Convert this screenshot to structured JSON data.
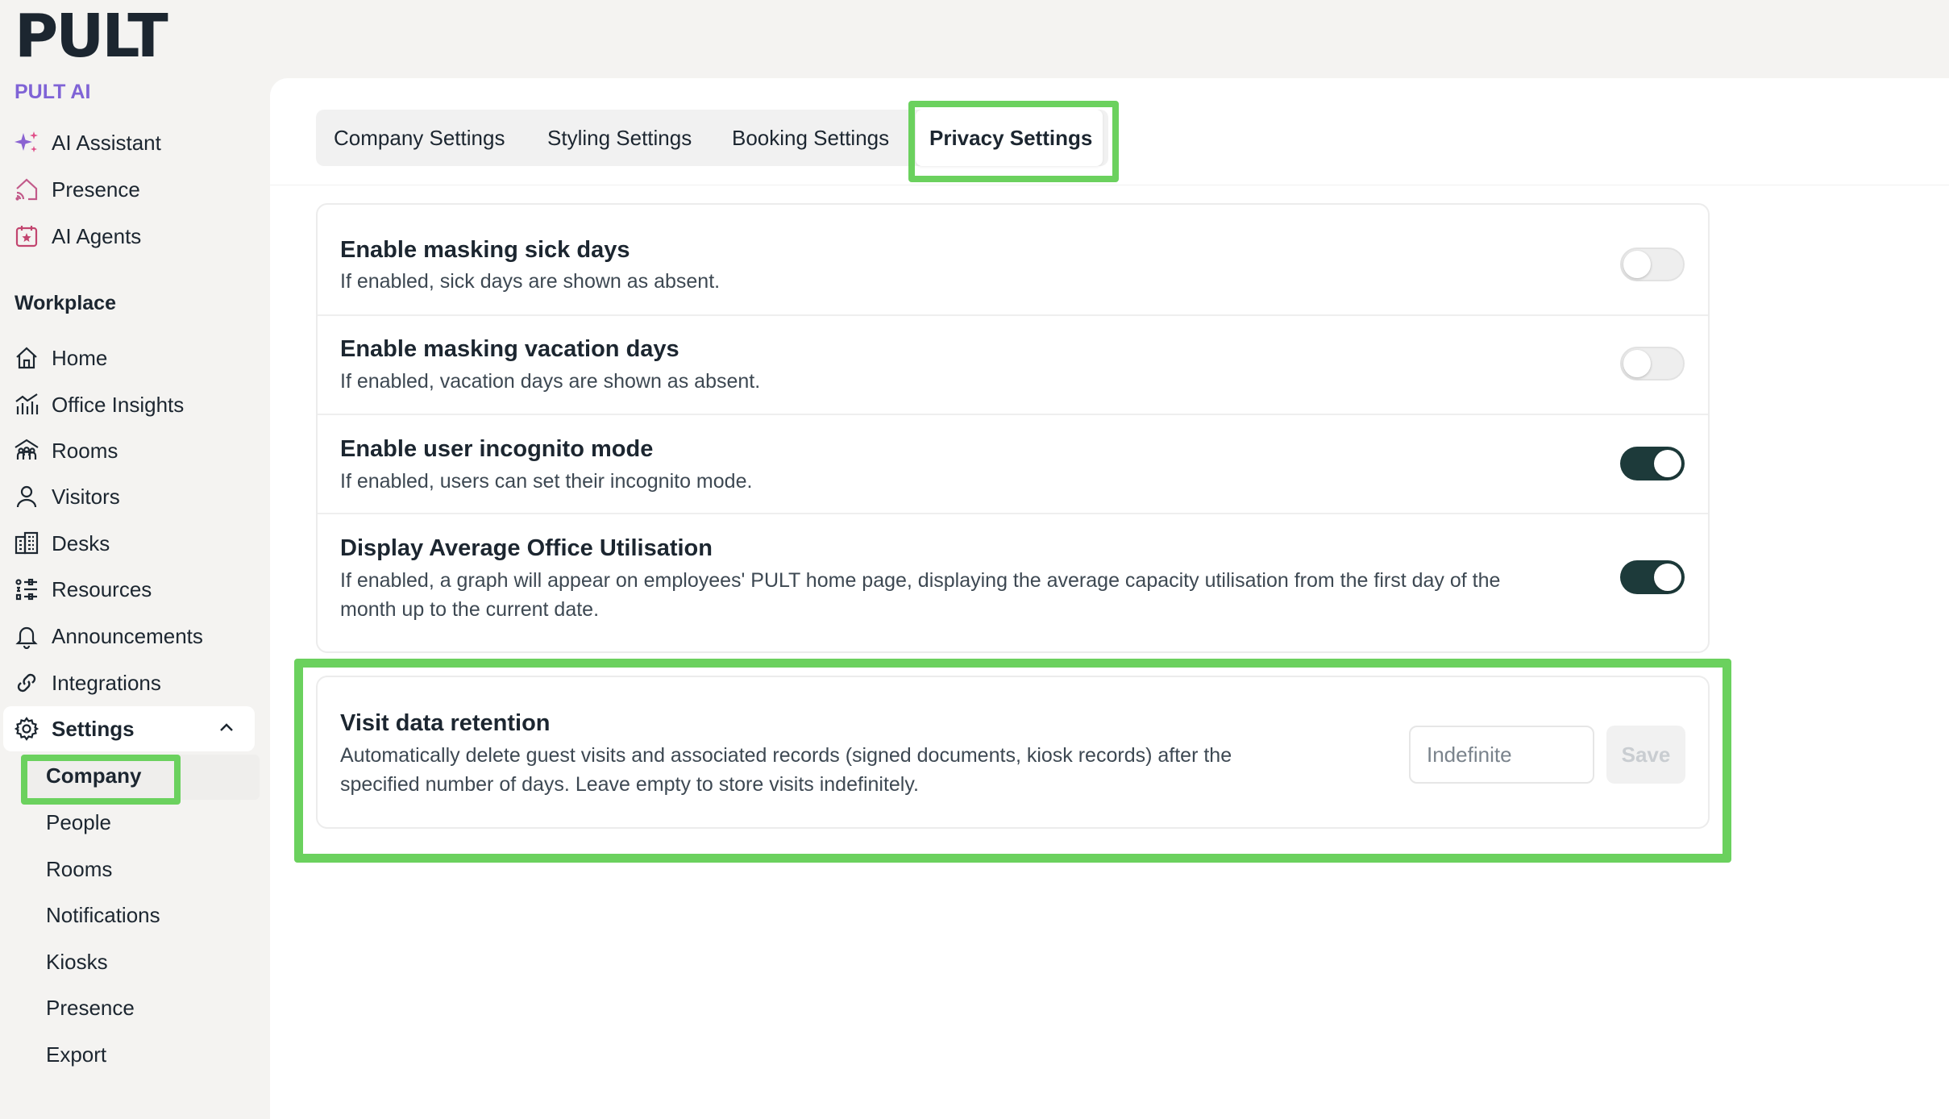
{
  "brand": {
    "logo": "PULT",
    "subtitle": "PULT AI"
  },
  "nav_top": [
    {
      "label": "AI Assistant",
      "icon": "sparkle-icon"
    },
    {
      "label": "Presence",
      "icon": "home-signal-icon"
    },
    {
      "label": "AI Agents",
      "icon": "calendar-star-icon"
    }
  ],
  "workplace": {
    "title": "Workplace",
    "items": [
      {
        "label": "Home",
        "icon": "home-icon"
      },
      {
        "label": "Office Insights",
        "icon": "bar-chart-icon"
      },
      {
        "label": "Rooms",
        "icon": "people-group-icon"
      },
      {
        "label": "Visitors",
        "icon": "user-icon"
      },
      {
        "label": "Desks",
        "icon": "building-icon"
      },
      {
        "label": "Resources",
        "icon": "list-icon"
      },
      {
        "label": "Announcements",
        "icon": "bell-icon"
      },
      {
        "label": "Integrations",
        "icon": "link-icon"
      }
    ]
  },
  "settings": {
    "label": "Settings",
    "icon": "gear-icon",
    "sub_items": [
      "Company",
      "People",
      "Rooms",
      "Notifications",
      "Kiosks",
      "Presence",
      "Export"
    ]
  },
  "tabs": [
    "Company Settings",
    "Styling Settings",
    "Booking Settings",
    "Privacy Settings"
  ],
  "active_tab": "Privacy Settings",
  "privacy_settings": [
    {
      "title": "Enable masking sick days",
      "description": "If enabled, sick days are shown as absent.",
      "enabled": false
    },
    {
      "title": "Enable masking vacation days",
      "description": "If enabled, vacation days are shown as absent.",
      "enabled": false
    },
    {
      "title": "Enable user incognito mode",
      "description": "If enabled, users can set their incognito mode.",
      "enabled": true
    },
    {
      "title": "Display Average Office Utilisation",
      "description_line1": "If enabled, a graph will appear on employees' PULT home page, displaying the average capacity utilisation from the first day of the",
      "description_line2": "month up to the current date.",
      "enabled": true
    }
  ],
  "retention": {
    "title": "Visit data retention",
    "description_line1": "Automatically delete guest visits and associated records (signed documents, kiosk records) after the",
    "description_line2": "specified number of days. Leave empty to store visits indefinitely.",
    "placeholder": "Indefinite",
    "value": "",
    "save_label": "Save"
  },
  "colors": {
    "accent_purple": "#7f63d6",
    "toggle_on": "#1d3a3a",
    "highlight_green": "#6bd15e"
  }
}
